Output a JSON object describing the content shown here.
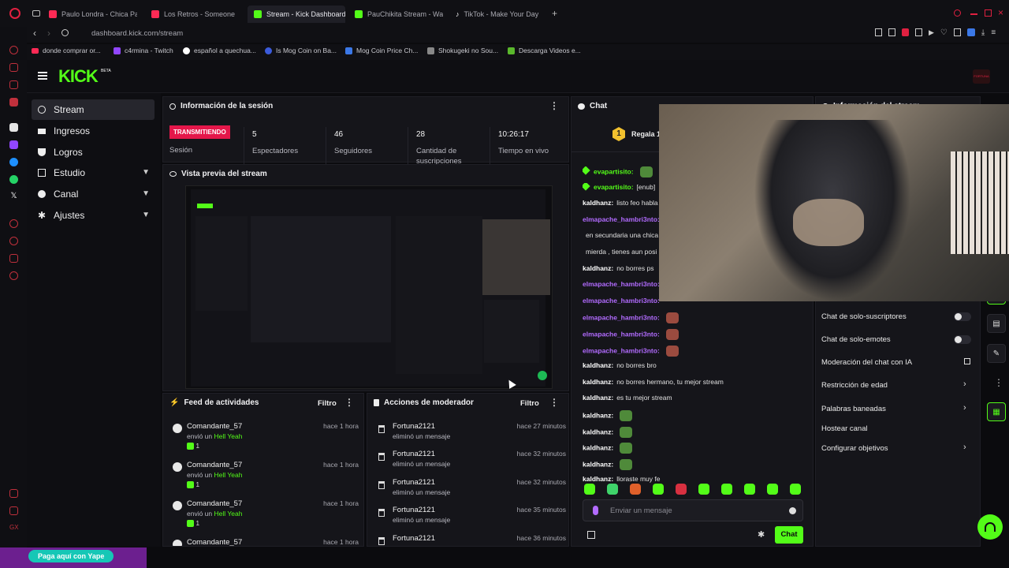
{
  "browser": {
    "tabs": [
      {
        "label": "Paulo Londra - Chica Par",
        "color": "#ff2a55"
      },
      {
        "label": "Los Retros - Someone",
        "color": "#ff2a55"
      },
      {
        "label": "Stream - Kick Dashboard",
        "color": "#53fc18"
      },
      {
        "label": "PauChikita Stream - Wat",
        "color": "#53fc18"
      },
      {
        "label": "TikTok - Make Your Day",
        "color": "#ffffff"
      }
    ],
    "url": "dashboard.kick.com/stream",
    "bookmarks": [
      "donde comprar or...",
      "c4rmina - Twitch",
      "español a quechua...",
      "Is Mog Coin on Ba...",
      "Mog Coin Price Ch...",
      "Shokugeki no Sou...",
      "Descarga Videos e..."
    ]
  },
  "kick": {
    "logo": "KICK",
    "beta": "BETA",
    "avatar_text": "FORTUNA"
  },
  "sidebar": {
    "items": [
      {
        "label": "Stream",
        "icon": "broadcast-icon",
        "expand": false
      },
      {
        "label": "Ingresos",
        "icon": "wallet-icon",
        "expand": false
      },
      {
        "label": "Logros",
        "icon": "trophy-icon",
        "expand": false
      },
      {
        "label": "Estudio",
        "icon": "studio-icon",
        "expand": true
      },
      {
        "label": "Canal",
        "icon": "channel-icon",
        "expand": true
      },
      {
        "label": "Ajustes",
        "icon": "gear-icon",
        "expand": true
      }
    ]
  },
  "session": {
    "title": "Información de la sesión",
    "status_badge": "TRANSMITIENDO",
    "status_label": "Sesión",
    "stats": [
      {
        "value": "5",
        "label": "Espectadores"
      },
      {
        "value": "46",
        "label": "Seguidores"
      },
      {
        "value": "28",
        "label": "Cantidad de suscripciones"
      },
      {
        "value": "10:26:17",
        "label": "Tiempo en vivo"
      }
    ]
  },
  "preview": {
    "title": "Vista previa del stream"
  },
  "feed": {
    "title": "Feed de actividades",
    "filter": "Filtro",
    "items": [
      {
        "name": "Comandante_57",
        "action": "envió un",
        "gift": "Hell Yeah",
        "count": "1",
        "time": "hace 1 hora"
      },
      {
        "name": "Comandante_57",
        "action": "envió un",
        "gift": "Hell Yeah",
        "count": "1",
        "time": "hace 1 hora"
      },
      {
        "name": "Comandante_57",
        "action": "envió un",
        "gift": "Hell Yeah",
        "count": "1",
        "time": "hace 1 hora"
      },
      {
        "name": "Comandante_57",
        "action": "",
        "gift": "",
        "count": "",
        "time": "hace 1 hora"
      }
    ]
  },
  "mod": {
    "title": "Acciones de moderador",
    "filter": "Filtro",
    "items": [
      {
        "name": "Fortuna2121",
        "action": "eliminó un mensaje",
        "time": "hace 27 minutos"
      },
      {
        "name": "Fortuna2121",
        "action": "eliminó un mensaje",
        "time": "hace 32 minutos"
      },
      {
        "name": "Fortuna2121",
        "action": "eliminó un mensaje",
        "time": "hace 32 minutos"
      },
      {
        "name": "Fortuna2121",
        "action": "eliminó un mensaje",
        "time": "hace 35 minutos"
      },
      {
        "name": "Fortuna2121",
        "action": "",
        "time": "hace 36 minutos"
      }
    ]
  },
  "chat": {
    "title": "Chat",
    "pinned_rank": "1",
    "pinned_text": "Regala 1",
    "messages": [
      {
        "user": "evapartisito:",
        "text": "",
        "color": "#53fc18",
        "emote": true
      },
      {
        "user": "evapartisito:",
        "text": "[enub]",
        "color": "#53fc18",
        "emote": false
      },
      {
        "user": "kaldhanz:",
        "text": "listo feo habla",
        "color": "#ffffff",
        "emote": false
      },
      {
        "user": "elmapache_hambri3nto:",
        "text": "",
        "color": "#b26bff",
        "emote": false
      },
      {
        "user": "",
        "text": "en secundaria una chica",
        "color": "#ffffff",
        "emote": false
      },
      {
        "user": "",
        "text": "mierda , tienes aun posi",
        "color": "#ffffff",
        "emote": false
      },
      {
        "user": "kaldhanz:",
        "text": "no borres ps",
        "color": "#ffffff",
        "emote": false
      },
      {
        "user": "elmapache_hambri3nto:",
        "text": "",
        "color": "#b26bff",
        "emote": false
      },
      {
        "user": "elmapache_hambri3nto:",
        "text": "",
        "color": "#b26bff",
        "emote": false
      },
      {
        "user": "elmapache_hambri3nto:",
        "text": "",
        "color": "#b26bff",
        "emote": true
      },
      {
        "user": "elmapache_hambri3nto:",
        "text": "",
        "color": "#b26bff",
        "emote": true
      },
      {
        "user": "elmapache_hambri3nto:",
        "text": "",
        "color": "#b26bff",
        "emote": true
      },
      {
        "user": "kaldhanz:",
        "text": "no borres bro",
        "color": "#ffffff",
        "emote": false
      },
      {
        "user": "kaldhanz:",
        "text": "no borres hermano, tu mejor stream",
        "color": "#ffffff",
        "emote": false
      },
      {
        "user": "kaldhanz:",
        "text": "es tu mejor stream",
        "color": "#ffffff",
        "emote": false
      },
      {
        "user": "kaldhanz:",
        "text": "",
        "color": "#ffffff",
        "emote": true
      },
      {
        "user": "kaldhanz:",
        "text": "",
        "color": "#ffffff",
        "emote": true
      },
      {
        "user": "kaldhanz:",
        "text": "",
        "color": "#ffffff",
        "emote": true
      },
      {
        "user": "kaldhanz:",
        "text": "",
        "color": "#ffffff",
        "emote": true
      },
      {
        "user": "kaldhanz:",
        "text": "lloraste muy fe",
        "color": "#ffffff",
        "emote": false
      }
    ],
    "input_placeholder": "Enviar un mensaje",
    "send_label": "Chat"
  },
  "settings": {
    "title": "Información del stream",
    "rows": [
      {
        "label": "Chat de solo-suscriptores",
        "kind": "toggle"
      },
      {
        "label": "Chat de solo-emotes",
        "kind": "toggle"
      },
      {
        "label": "Moderación del chat con IA",
        "kind": "link"
      },
      {
        "label": "Restricción de edad",
        "kind": "chevron"
      },
      {
        "label": "Palabras baneadas",
        "kind": "chevron"
      },
      {
        "label": "Hostear canal",
        "kind": "none"
      },
      {
        "label": "Configurar objetivos",
        "kind": "chevron"
      }
    ]
  },
  "yape": {
    "label": "Paga aquí con Yape"
  },
  "colors": {
    "accent": "#53fc18",
    "live": "#e4174a",
    "purple": "#b26bff"
  }
}
